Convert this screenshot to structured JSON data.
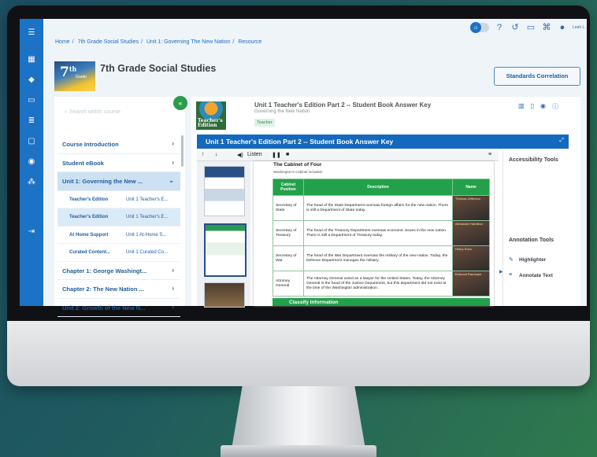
{
  "breadcrumb": [
    "Home",
    "7th Grade Social Studies",
    "Unit 1: Governing The New Nation",
    "Resource"
  ],
  "user": {
    "name": "Leah L."
  },
  "course": {
    "logo_grade": "7",
    "logo_suffix": "th",
    "logo_sub": "Grade",
    "title": "7th Grade Social Studies",
    "standards_button": "Standards Correlation",
    "search_placeholder": "Search within course"
  },
  "nav": [
    {
      "label": "Course Introduction",
      "type": "item",
      "chevron": "›"
    },
    {
      "label": "Student eBook",
      "type": "item",
      "chevron": "›"
    },
    {
      "label": "Unit 1: Governing the New ...",
      "type": "item",
      "active": true,
      "chevron": "⌄"
    },
    {
      "kind": "Teacher's Edition",
      "value": "Unit 1 Teacher's E...",
      "type": "sub"
    },
    {
      "kind": "Teacher's Edition",
      "value": "Unit 1 Teacher's E...",
      "type": "sub",
      "selected": true
    },
    {
      "kind": "At Home Support",
      "value": "Unit 1 At-Home S...",
      "type": "sub"
    },
    {
      "kind": "Curated Content...",
      "value": "Unit 1 Curated Co...",
      "type": "sub"
    },
    {
      "label": "Chapter 1: George Washingt...",
      "type": "item",
      "chevron": "›"
    },
    {
      "label": "Chapter 2: The New Nation ...",
      "type": "item",
      "chevron": "›"
    },
    {
      "label": "Unit 2: Growth of the New N...",
      "type": "item",
      "chevron": "›"
    }
  ],
  "resource": {
    "thumb_text": "Teacher's Edition",
    "title": "Unit 1 Teacher's Edition Part 2 -- Student Book Answer Key",
    "subtitle": "Governing the New Nation",
    "tag": "Teacher",
    "viewer_title": "Unit 1 Teacher's Edition Part 2 -- Student Book Answer Key"
  },
  "toolbar": {
    "up": "↑",
    "down": "↓",
    "listen": "Listen",
    "pause": "❚❚",
    "stop": "■",
    "menu": "≡"
  },
  "document": {
    "heading": "The Cabinet of Four",
    "subheading": "Washington's Cabinet included:",
    "columns": [
      "Cabinet Position",
      "Description",
      "Name"
    ],
    "rows": [
      {
        "position": "Secretary of State",
        "description": "The head of the State Department oversaw foreign affairs for the new nation. There is still a Department of State today.",
        "name": "Thomas Jefferson"
      },
      {
        "position": "Secretary of Treasury",
        "description": "The head of the Treasury Department oversaw economic issues in the new nation. There is still a Department of Treasury today.",
        "name": "Alexander Hamilton"
      },
      {
        "position": "Secretary of War",
        "description": "The head of the War Department oversaw the military of the new nation. Today, the Defense Department manages the military.",
        "name": "Henry Knox"
      },
      {
        "position": "Attorney General",
        "description": "The Attorney General acted as a lawyer for the United States. Today, the Attorney General is the head of the Justice Department, but this department did not exist at the time of the Washington administration.",
        "name": "Edmund Randolph"
      }
    ],
    "classify_label": "Classify Information"
  },
  "right_panel": {
    "accessibility": "Accessibility Tools",
    "annotation": "Annotation Tools",
    "highlighter": "Highlighter",
    "annotate": "Annotate Text"
  },
  "colors": {
    "brand": "#1c72c5",
    "green": "#22a04a",
    "link": "#1f5ea0"
  }
}
